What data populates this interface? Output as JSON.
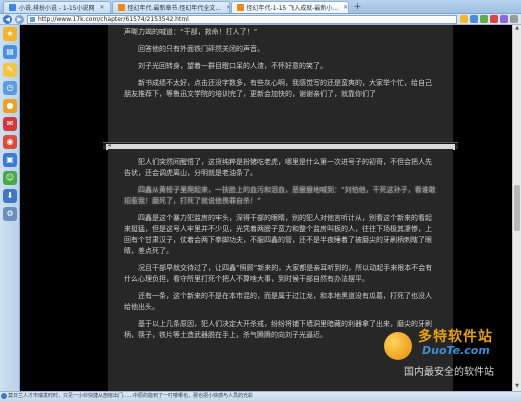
{
  "browser": {
    "tabs": [
      {
        "label": "小说.排扮小说 - 1-15小说网",
        "active": false,
        "color": "#3f8ad8"
      },
      {
        "label": "怪幻年代.最新章节.怪幻年代全文...",
        "active": false,
        "color": "#e98a1a"
      },
      {
        "label": "怪幻年代-1-15 飞入成就-最新小...",
        "active": true,
        "color": "#e98a1a"
      }
    ],
    "url": "http://www.17k.com/chapter/61574/2153542.html",
    "status_text": "莫日兰人才市瑞发时时，只见一小伙快捷从剖房出门……中原的能到了一叮喽哪也，那也把小快感与人员的光彩"
  },
  "reader": {
    "top_paragraphs": [
      "声嘶力竭的喊道：“干部，救命！打人了！”",
      "回答他的只有外面铁门砰然关闭的声音。",
      "刘子光回转身，望着一群目瞪口呆的人渣，不怀好意的笑了。",
      "新书成绩不太好，点击还没字数多，有些灰心啊，我感觉写的还是蛮爽的，大家举个忙，给自己朋友推荐下，等鲁迅文学院的培训完了，更新会加快的，谢谢亲们了，就靠你们了"
    ],
    "fold_label": "4",
    "bottom_paragraphs": [
      "犯人们突然间醒悟了，这货纯粹是扮猪吃老虎，哪里是什么第一次进号子的初哥，不但会把人先告状，还会调虎离山，分明就是老油条了。",
      "四鑫从黄榜子里爬起来，一扶脸上的血污和泪血，恶狠狠地喊到：“刘怕他，干死这孙子，看谁敢招惹我！磨死了，打死了就说他畏罪自杀！”",
      "四鑫是这个暴力犯监房的牢头，深得干部的眼睛，别的犯人对他言听计从，别看这个新来的看起来挺猛，但是这号人牢里并不少见，光凭着两膀子蛮力和整个监房叫板的人，往往下场极其凄惨，上回有个甘肃汉子，仗着会两下拳脚功夫，不服四鑫的管，还不是半夜睡着了被磨尖的牙刷柄刺瞎了眼睛，差点死了。",
      "况且干部早就交待过了，让四鑫“照顾”新来的，大家都是亲耳听到的，所以动起手来根本不会有什么心理负担，看守所里打死个把人不算啥大事，到时候干部自然有办法摆平。",
      "还有一条，这个新来的不是在本市混的，而是属于过江龙，和本地黑道没有瓜葛，打死了也没人给他出头。",
      "基于以上几条原因，犯人们决定大开杀戒，纷纷将铺下墙洞里暗藏的利器拿了出来，磨尖的牙刷柄，筷子，铁片等土造武器脱在手上，杀气腾腾的向刘子光逼近。"
    ]
  },
  "watermark": {
    "main": "多特软件站",
    "site": "DuoTe.com",
    "sub": "国内最安全的软件站"
  }
}
